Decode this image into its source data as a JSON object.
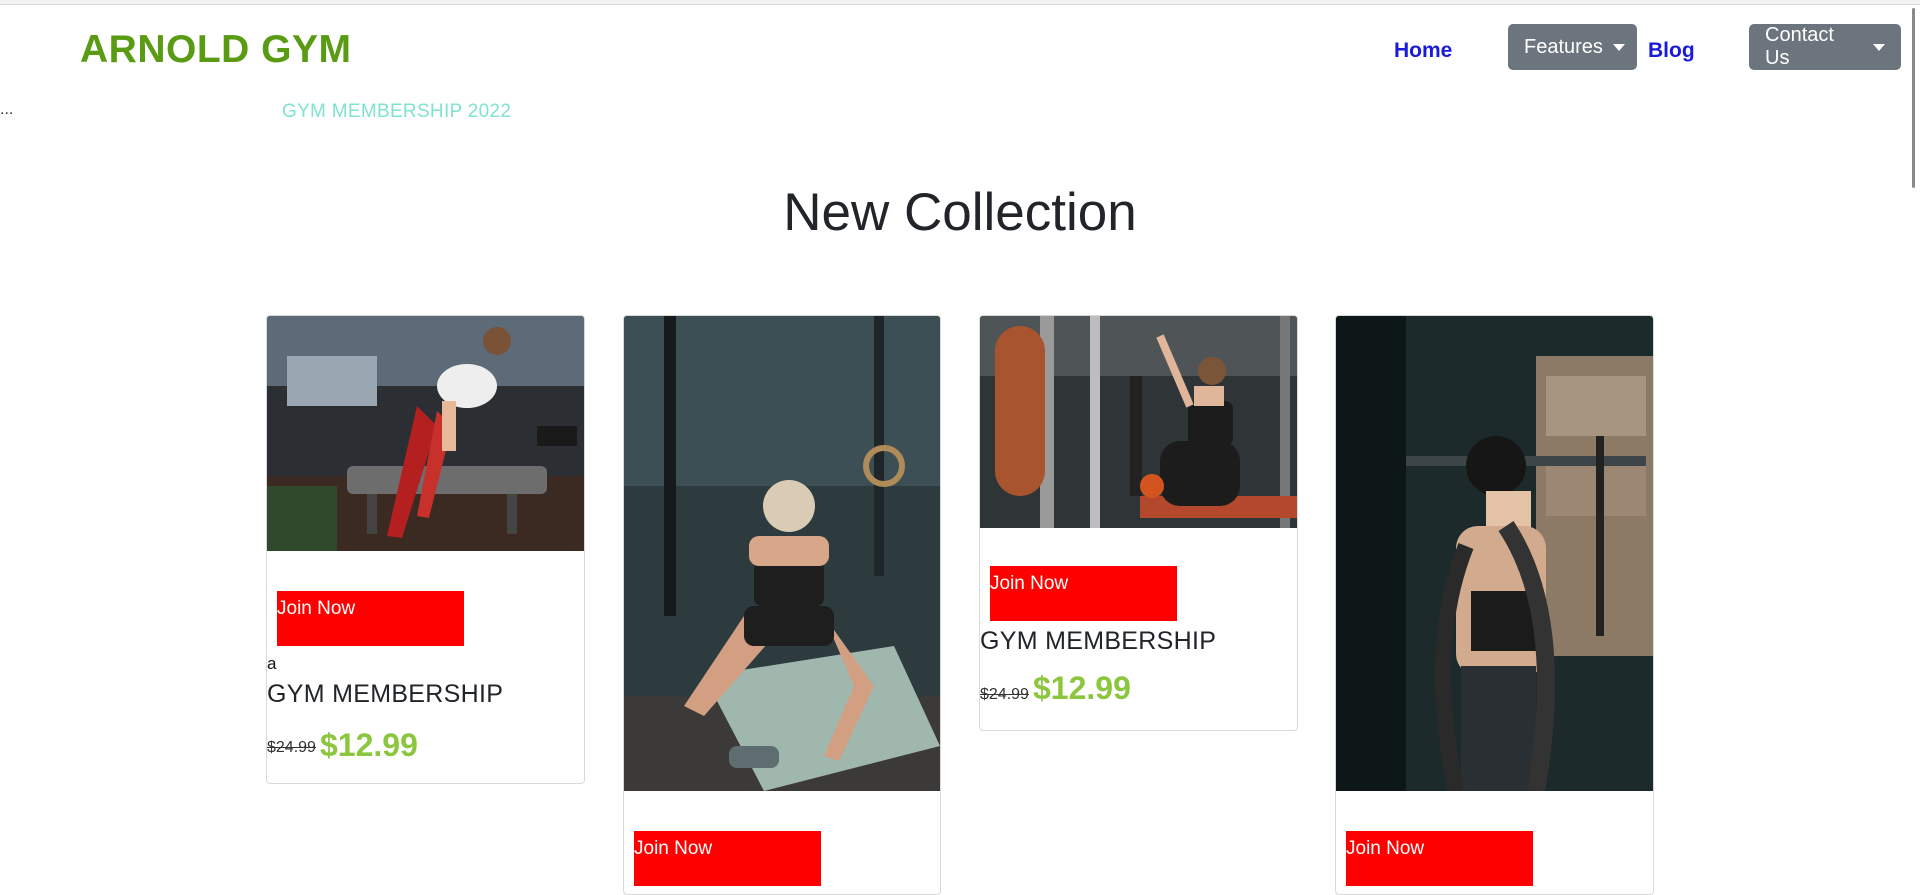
{
  "brand": {
    "name": "ARNOLD GYM",
    "color": "#5a9b14"
  },
  "nav": {
    "home": "Home",
    "features": "Features",
    "blog": "Blog",
    "contact": "Contact Us"
  },
  "ellipsis": "...",
  "promo": "GYM MEMBERSHIP 2022",
  "section_title": "New Collection",
  "cards": [
    {
      "join": "Join Now",
      "text": "a",
      "title": "GYM MEMBERSHIP",
      "old_price": "$24.99",
      "new_price": "$12.99"
    },
    {
      "join": "Join Now"
    },
    {
      "join": "Join Now",
      "title": "GYM MEMBERSHIP",
      "old_price": "$24.99",
      "new_price": "$12.99"
    },
    {
      "join": "Join Now"
    }
  ],
  "colors": {
    "join_button": "#ff0000",
    "price": "#8cc63f",
    "nav_link": "#1a1adb",
    "dropdown": "#6c757d"
  }
}
